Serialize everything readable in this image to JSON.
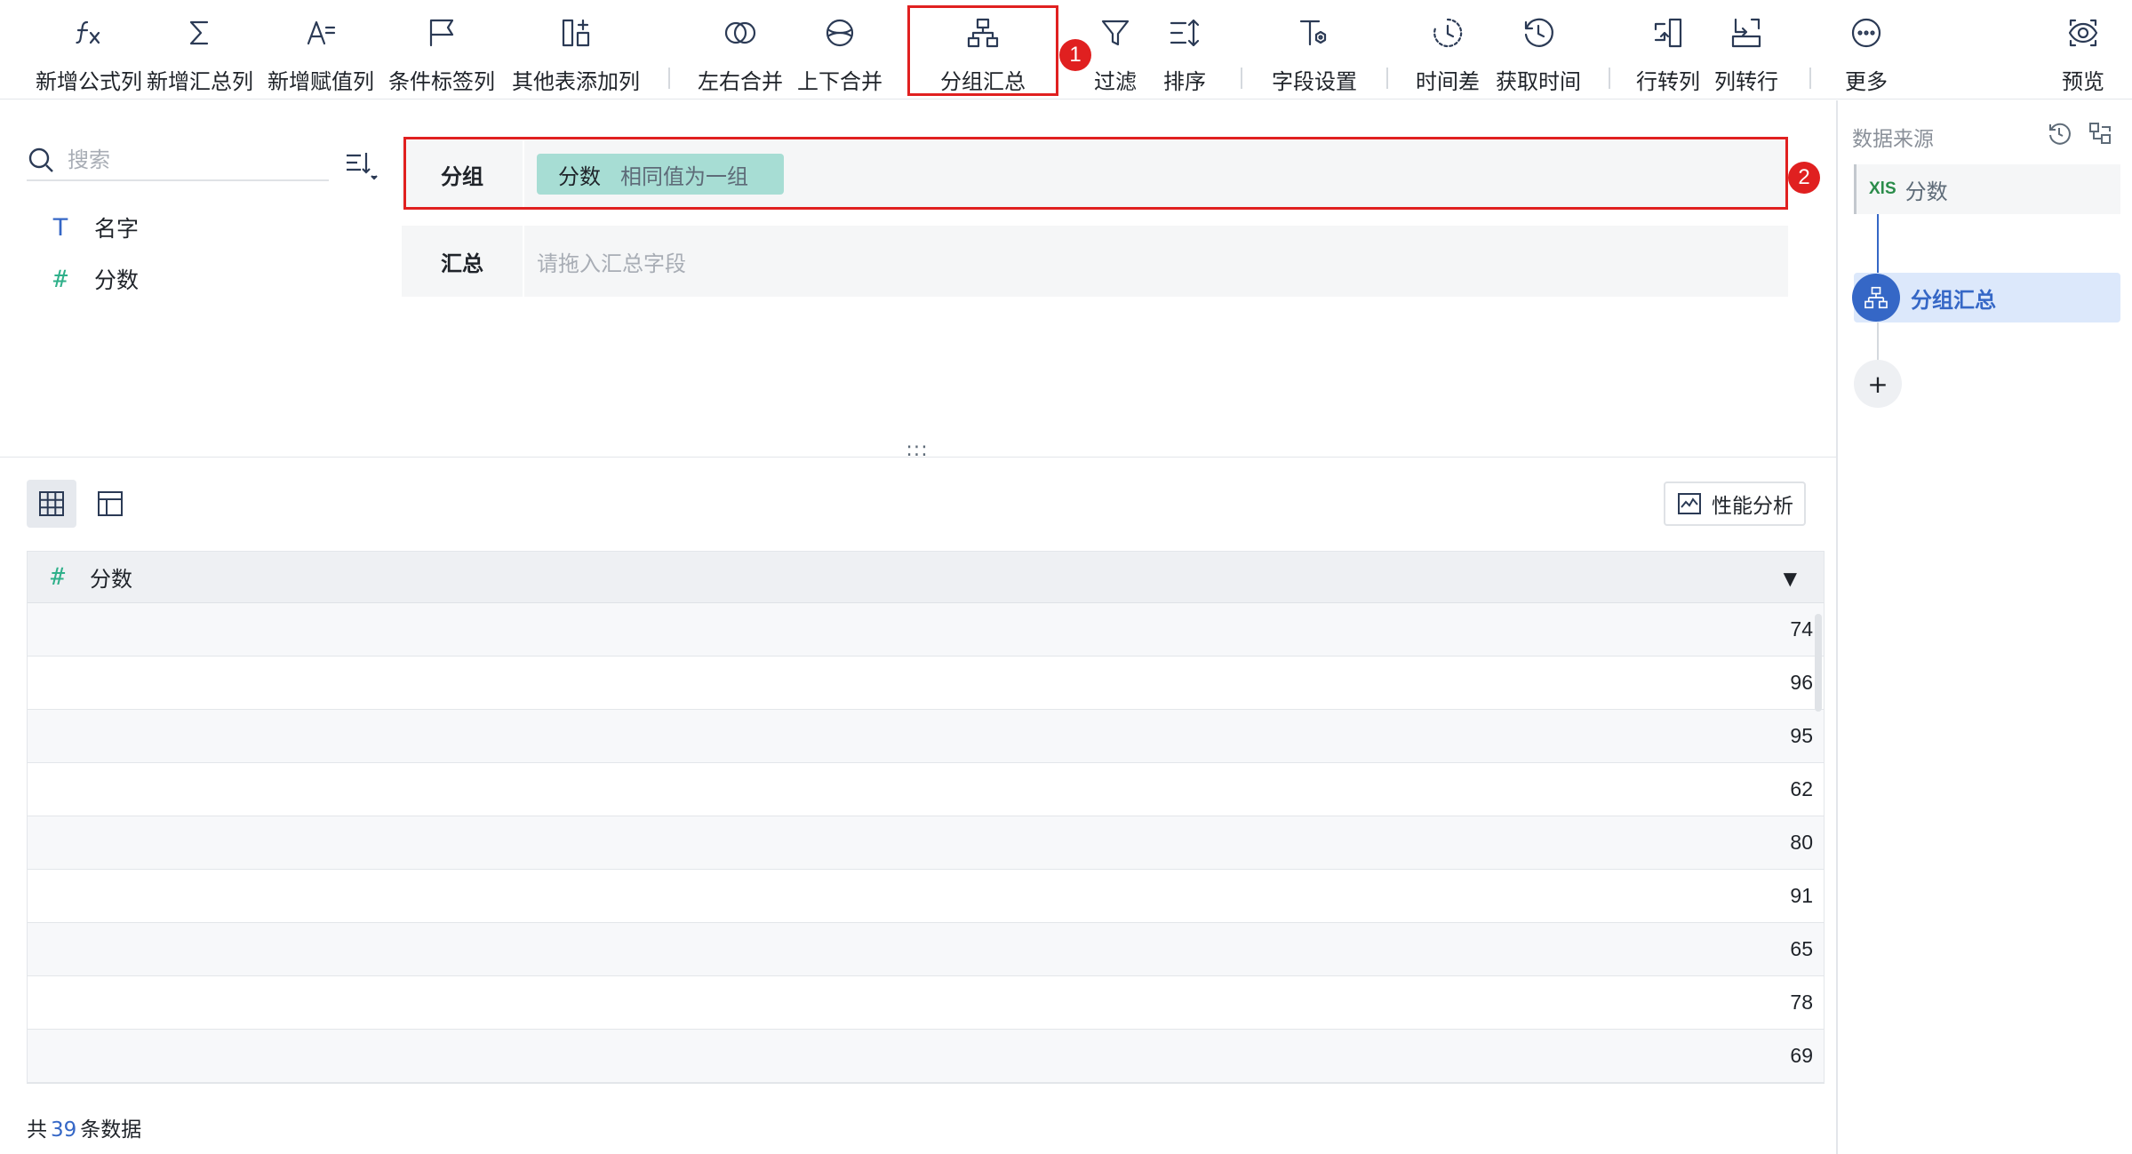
{
  "toolbar": {
    "items": [
      {
        "label": "新增公式列",
        "icon": "formula-icon"
      },
      {
        "label": "新增汇总列",
        "icon": "sigma-icon"
      },
      {
        "label": "新增赋值列",
        "icon": "assign-icon"
      },
      {
        "label": "条件标签列",
        "icon": "flag-icon"
      },
      {
        "label": "其他表添加列",
        "icon": "add-column-icon"
      },
      {
        "label": "左右合并",
        "icon": "venn-icon"
      },
      {
        "label": "上下合并",
        "icon": "stack-icon"
      },
      {
        "label": "分组汇总",
        "icon": "group-tree-icon"
      },
      {
        "label": "过滤",
        "icon": "filter-icon"
      },
      {
        "label": "排序",
        "icon": "sort-icon"
      },
      {
        "label": "字段设置",
        "icon": "field-settings-icon"
      },
      {
        "label": "时间差",
        "icon": "clock-icon"
      },
      {
        "label": "获取时间",
        "icon": "clock-fetch-icon"
      },
      {
        "label": "行转列",
        "icon": "row-to-col-icon"
      },
      {
        "label": "列转行",
        "icon": "col-to-row-icon"
      },
      {
        "label": "更多",
        "icon": "more-icon"
      },
      {
        "label": "预览",
        "icon": "eye-icon"
      }
    ],
    "badges": [
      "1",
      "2"
    ]
  },
  "fields_panel": {
    "search_placeholder": "搜索",
    "fields": [
      {
        "type": "text",
        "type_glyph": "T",
        "name": "名字"
      },
      {
        "type": "number",
        "type_glyph": "#",
        "name": "分数"
      }
    ]
  },
  "config": {
    "group_label": "分组",
    "group_field": "分数",
    "group_mode": "相同值为一组",
    "summary_label": "汇总",
    "summary_placeholder": "请拖入汇总字段"
  },
  "preview": {
    "splitter_glyph": ":::",
    "perf_button": "性能分析",
    "column": {
      "type_glyph": "#",
      "name": "分数",
      "caret": "▼"
    },
    "rows": [
      74,
      96,
      95,
      62,
      80,
      91,
      65,
      78,
      69
    ],
    "footer_prefix": "共",
    "footer_count": "39",
    "footer_suffix": "条数据"
  },
  "steps_panel": {
    "title": "数据来源",
    "source_badge": "XlS",
    "source_name": "分数",
    "current_step": "分组汇总",
    "add_glyph": "+"
  },
  "colors": {
    "accent": "#3567c6",
    "chip": "#a7ddd4",
    "highlight": "#e02020",
    "number_type": "#2fb08a"
  }
}
